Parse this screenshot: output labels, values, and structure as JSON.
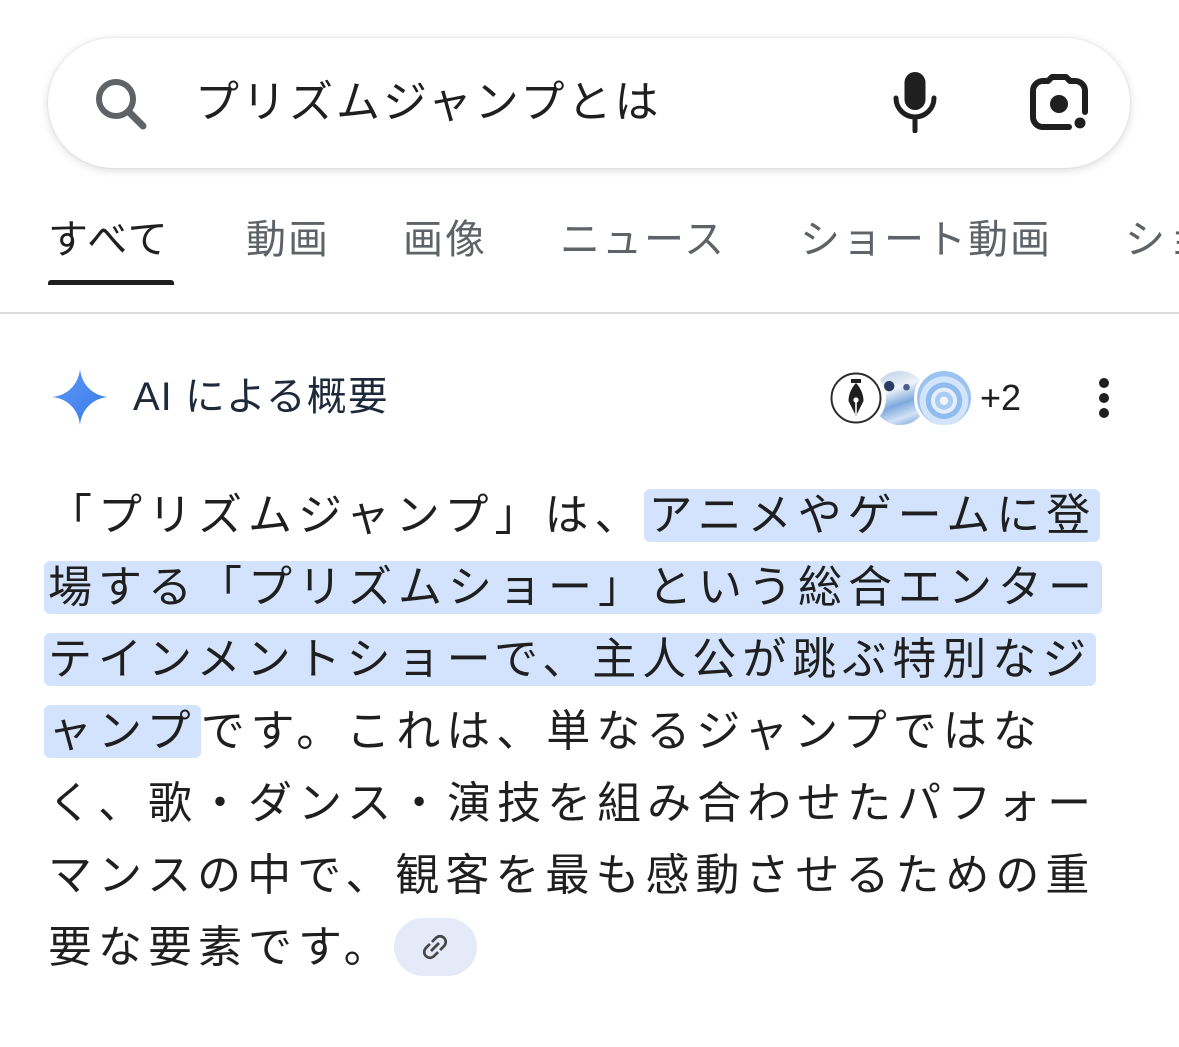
{
  "search": {
    "query": "プリズムジャンプとは",
    "search_icon": "search-icon",
    "mic_icon": "mic-icon",
    "lens_icon": "google-lens-icon"
  },
  "tabs": [
    {
      "label": "すべて",
      "selected": true
    },
    {
      "label": "動画",
      "selected": false
    },
    {
      "label": "画像",
      "selected": false
    },
    {
      "label": "ニュース",
      "selected": false
    },
    {
      "label": "ショート動画",
      "selected": false
    },
    {
      "label": "ショ",
      "selected": false
    }
  ],
  "ai_overview": {
    "icon": "sparkle-icon",
    "title": "AI による概要",
    "sources": {
      "avatars": [
        "pen-nib-icon",
        "source-thumbnail",
        "rose-thumbnail"
      ],
      "more_count": "+2"
    },
    "menu_icon": "more-vert-icon",
    "lines": [
      [
        {
          "text": "「プリズムジャンプ」は、",
          "highlight": false
        },
        {
          "text": "アニメやゲームに登",
          "highlight": true
        }
      ],
      [
        {
          "text": "場する「プリズムショー」という総合エンター",
          "highlight": true
        }
      ],
      [
        {
          "text": "テインメントショーで、主人公が跳ぶ特別なジ",
          "highlight": true
        }
      ],
      [
        {
          "text": "ャンプ",
          "highlight": true
        },
        {
          "text": "です。これは、単なるジャンプではな",
          "highlight": false
        }
      ],
      [
        {
          "text": "く、歌・ダンス・演技を組み合わせたパフォー",
          "highlight": false
        }
      ],
      [
        {
          "text": "マンスの中で、観客を最も感動させるための重",
          "highlight": false
        }
      ],
      [
        {
          "text": "要な要素です。",
          "highlight": false
        }
      ]
    ],
    "link_chip_icon": "link-icon"
  },
  "colors": {
    "text": "#1f1f1f",
    "muted": "#5f6368",
    "accent": "#4285f4",
    "highlight": "#d3e3fd",
    "chip": "#e5eaf9",
    "divider": "#dadce0"
  }
}
